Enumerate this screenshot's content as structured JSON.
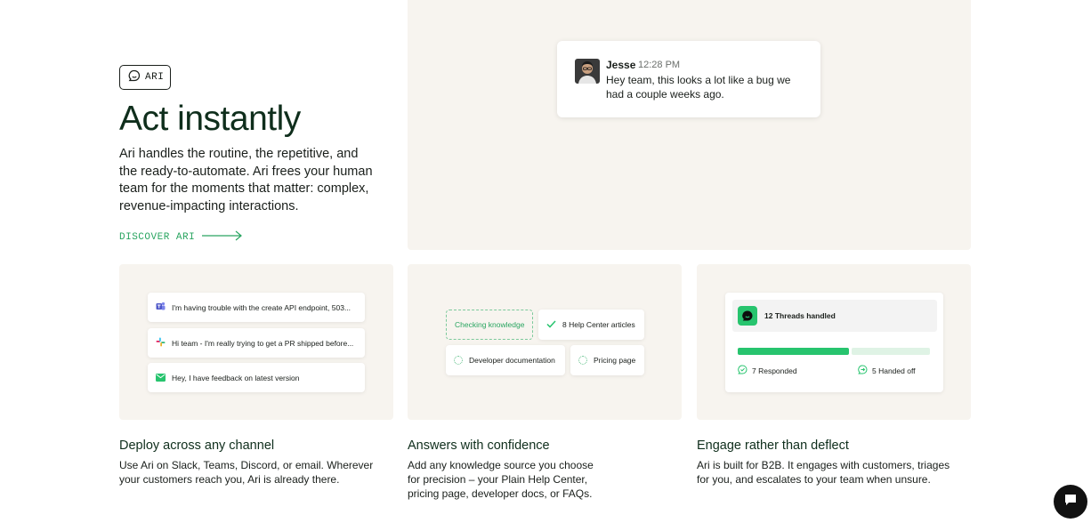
{
  "hero": {
    "badge": "ARI",
    "title": "Act instantly",
    "description": "Ari handles the routine, the repetitive, and the ready-to-automate. Ari frees your human team for the moments that matter: complex, revenue-impacting interactions.",
    "cta": "DISCOVER ARI"
  },
  "message": {
    "name": "Jesse",
    "time": "12:28 PM",
    "text": "Hey team, this looks a lot like a bug we had a couple weeks ago."
  },
  "channels": [
    {
      "icon": "teams-icon",
      "text": "I'm having trouble with the create API endpoint, 503..."
    },
    {
      "icon": "slack-icon",
      "text": "Hi team - I'm really trying to get a PR shipped before..."
    },
    {
      "icon": "email-icon",
      "text": "Hey, I have feedback on latest version"
    }
  ],
  "knowledge": {
    "checking": "Checking knowledge",
    "articles": "8 Help Center articles",
    "docs": "Developer documentation",
    "pricing": "Pricing page"
  },
  "threads": {
    "title": "12 Threads handled",
    "responded": "7 Responded",
    "handed_off": "5 Handed off",
    "responded_fraction": 0.58
  },
  "features": [
    {
      "title": "Deploy across any channel",
      "description": "Use Ari on Slack, Teams, Discord, or email. Wherever your customers reach you, Ari is already there."
    },
    {
      "title": "Answers with confidence",
      "description": "Add any knowledge source you choose for precision – your Plain Help Center, pricing page, developer docs, or FAQs."
    },
    {
      "title": "Engage rather than deflect",
      "description": "Ari is built for B2B. It engages with customers, triages for you, and escalates to your team when unsure."
    }
  ],
  "colors": {
    "accent": "#2aa561",
    "panel": "#f7f4ef",
    "progress": "#27c46e"
  }
}
